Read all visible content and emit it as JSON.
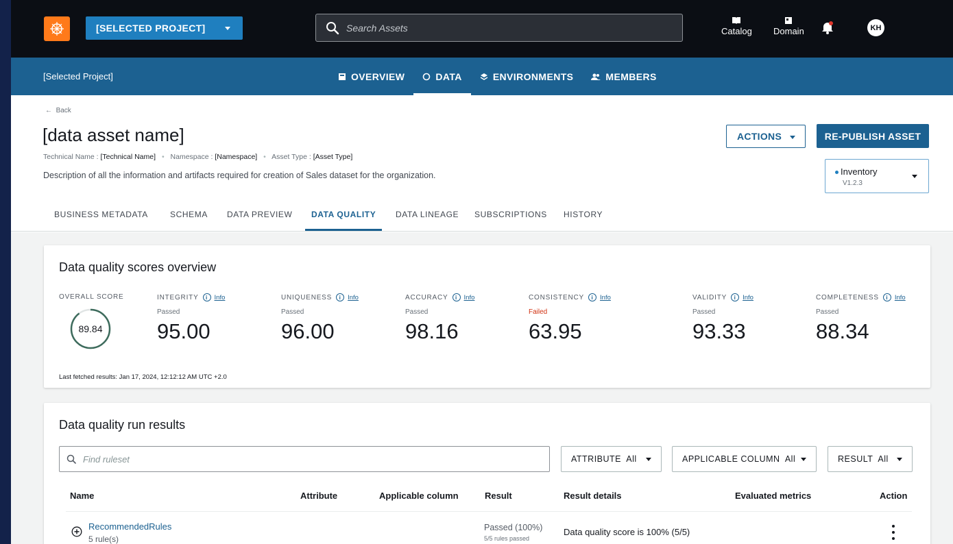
{
  "topbar": {
    "project_select": "[SELECTED PROJECT]",
    "search_placeholder": "Search Assets",
    "catalog_label": "Catalog",
    "domain_label": "Domain",
    "avatar_initials": "KH"
  },
  "project_nav": {
    "project_name": "[Selected Project]",
    "tabs": [
      {
        "label": "OVERVIEW",
        "icon": "overview-icon"
      },
      {
        "label": "DATA",
        "icon": "data-circle-icon"
      },
      {
        "label": "ENVIRONMENTS",
        "icon": "environments-icon"
      },
      {
        "label": "MEMBERS",
        "icon": "members-icon"
      }
    ],
    "active_tab": "DATA"
  },
  "asset": {
    "back_label": "Back",
    "title": "[data asset name]",
    "technical_name_label": "Technical Name :",
    "technical_name": "[Technical Name]",
    "namespace_label": "Namespace :",
    "namespace": "[Namespace]",
    "asset_type_label": "Asset Type :",
    "asset_type": "[Asset Type]",
    "description": "Description of all the information and artifacts required for creation of Sales dataset for the organization.",
    "actions_label": "ACTIONS",
    "republish_label": "RE-PUBLISH ASSET",
    "version_name": "Inventory",
    "version_number": "V1.2.3"
  },
  "asset_tabs": [
    "BUSINESS METADATA",
    "SCHEMA",
    "DATA PREVIEW",
    "DATA QUALITY",
    "DATA LINEAGE",
    "SUBSCRIPTIONS",
    "HISTORY"
  ],
  "active_asset_tab": "DATA QUALITY",
  "scores": {
    "title": "Data quality scores overview",
    "overall_label": "OVERALL SCORE",
    "overall_value": "89.84",
    "overall_fraction": 0.8984,
    "info_link": "Info",
    "metrics": [
      {
        "label": "INTEGRITY",
        "status": "Passed",
        "value": "95.00"
      },
      {
        "label": "UNIQUENESS",
        "status": "Passed",
        "value": "96.00"
      },
      {
        "label": "ACCURACY",
        "status": "Passed",
        "value": "98.16"
      },
      {
        "label": "CONSISTENCY",
        "status": "Failed",
        "value": "63.95"
      },
      {
        "label": "VALIDITY",
        "status": "Passed",
        "value": "93.33"
      },
      {
        "label": "COMPLETENESS",
        "status": "Passed",
        "value": "88.34"
      }
    ],
    "last_fetched": "Last fetched results: Jan 17, 2024, 12:12:12 AM UTC +2.0",
    "colors": {
      "circle": "#3d6b5c",
      "failed": "#d13212"
    }
  },
  "run_results": {
    "title": "Data quality run results",
    "find_placeholder": "Find ruleset",
    "filters": {
      "attribute": "ATTRIBUTE  All",
      "applicable_column": "APPLICABLE COLUMN  All",
      "result": "RESULT  All"
    },
    "columns": [
      "Name",
      "Attribute",
      "Applicable column",
      "Result",
      "Result details",
      "Evaluated metrics",
      "Action"
    ],
    "rows": [
      {
        "name": "RecommendedRules",
        "rule_count": "5 rule(s)",
        "result": "Passed (100%)",
        "result_sub": "5/5 rules passed",
        "result_details": "Data quality score is 100% (5/5)"
      }
    ]
  }
}
